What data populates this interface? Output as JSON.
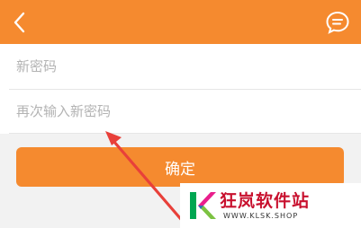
{
  "header": {
    "back_icon": "chevron-left-icon",
    "message_icon": "chat-bubble-icon",
    "color": "#f58a2f"
  },
  "form": {
    "new_password_placeholder": "新密码",
    "confirm_password_placeholder": "再次输入新密码"
  },
  "actions": {
    "confirm_label": "确定"
  },
  "annotation": {
    "arrow_color": "#e8403a"
  },
  "watermark": {
    "title": "狂岚软件站",
    "url": "WWW.KLSK.SHOP"
  }
}
